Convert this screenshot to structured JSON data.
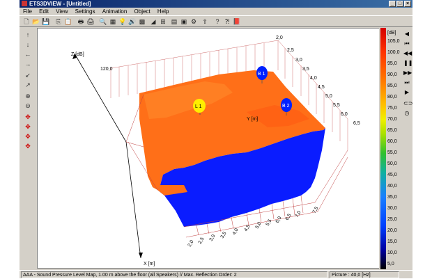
{
  "window": {
    "title": "ETS3DVIEW - [Untitled]",
    "controls": {
      "minimize": "_",
      "maximize": "□",
      "close": "×"
    }
  },
  "menu": [
    "File",
    "Edit",
    "View",
    "Settings",
    "Animation",
    "Object",
    "Help"
  ],
  "toolbar_icons": [
    {
      "name": "new-file-icon",
      "glyph": "🗋"
    },
    {
      "name": "open-folder-icon",
      "glyph": "📂"
    },
    {
      "name": "save-icon",
      "glyph": "💾"
    },
    {
      "name": "copy-icon",
      "glyph": "⎘"
    },
    {
      "name": "paste-icon",
      "glyph": "📋"
    },
    {
      "name": "print-icon",
      "glyph": "🖶"
    },
    {
      "name": "print-preview-icon",
      "glyph": "🖨"
    },
    {
      "name": "zoom-icon",
      "glyph": "🔍"
    },
    {
      "name": "grid-icon",
      "glyph": "▦"
    },
    {
      "name": "bulb-icon",
      "glyph": "💡"
    },
    {
      "name": "speaker-icon",
      "glyph": "🔊"
    },
    {
      "name": "color-map-icon",
      "glyph": "▩"
    },
    {
      "name": "chart-icon",
      "glyph": "◢"
    },
    {
      "name": "graph-icon",
      "glyph": "⊞"
    },
    {
      "name": "table-icon",
      "glyph": "▤"
    },
    {
      "name": "image-icon",
      "glyph": "▣"
    },
    {
      "name": "settings-icon",
      "glyph": "⚙"
    },
    {
      "name": "export-icon",
      "glyph": "⇪"
    },
    {
      "name": "help-icon",
      "glyph": "?"
    },
    {
      "name": "context-help-icon",
      "glyph": "⁈"
    },
    {
      "name": "book-icon",
      "glyph": "📕"
    }
  ],
  "left_tools": [
    {
      "name": "move-up-icon",
      "glyph": "↑"
    },
    {
      "name": "move-down-icon",
      "glyph": "↓"
    },
    {
      "name": "move-left-icon",
      "glyph": "←"
    },
    {
      "name": "move-right-icon",
      "glyph": "→"
    },
    {
      "name": "diagonal-in-icon",
      "glyph": "↙"
    },
    {
      "name": "diagonal-out-icon",
      "glyph": "↗"
    },
    {
      "name": "zoom-in-icon",
      "glyph": "⊕"
    },
    {
      "name": "zoom-out-icon",
      "glyph": "⊖"
    },
    {
      "name": "rotate-x-icon",
      "glyph": "✥"
    },
    {
      "name": "rotate-y-icon",
      "glyph": "✥"
    },
    {
      "name": "rotate-z-icon",
      "glyph": "✥"
    },
    {
      "name": "reset-view-icon",
      "glyph": "✥"
    }
  ],
  "right_tools": [
    {
      "name": "play-back-icon",
      "glyph": "◀"
    },
    {
      "name": "first-frame-icon",
      "glyph": "⏮"
    },
    {
      "name": "rewind-icon",
      "glyph": "◀◀"
    },
    {
      "name": "pause-icon",
      "glyph": "❚❚"
    },
    {
      "name": "fast-forward-icon",
      "glyph": "▶▶"
    },
    {
      "name": "last-frame-icon",
      "glyph": "⏭"
    },
    {
      "name": "play-icon",
      "glyph": "▶"
    },
    {
      "name": "link-icon",
      "glyph": "⊂⊃"
    },
    {
      "name": "clock-icon",
      "glyph": "◷"
    }
  ],
  "legend": {
    "unit": "[dB]",
    "labels": [
      "105,0",
      "100,0",
      "95,0",
      "90,0",
      "85,0",
      "80,0",
      "75,0",
      "70,0",
      "65,0",
      "60,0",
      "55,0",
      "50,0",
      "45,0",
      "40,0",
      "35,0",
      "30,0",
      "25,0",
      "20,0",
      "15,0",
      "10,0",
      "5,0"
    ]
  },
  "plot": {
    "z_axis_label": "Z [dB]",
    "z_tick": "120,0",
    "y_axis_label": "Y [m]",
    "x_axis_label": "X [m]",
    "y_ticks": [
      "2,0",
      "2,5",
      "3,0",
      "3,5",
      "4,0",
      "4,5",
      "5,0",
      "5,5",
      "6,0",
      "6,5"
    ],
    "x_ticks": [
      "2,0",
      "2,5",
      "3,0",
      "3,5",
      "4,0",
      "4,5",
      "5,0",
      "5,5",
      "6,0",
      "6,5",
      "7,0",
      "7,5"
    ],
    "markers": [
      {
        "label": "L 1",
        "color": "#ffee00"
      },
      {
        "label": "B 1",
        "color": "#0020ff"
      },
      {
        "label": "B 2",
        "color": "#0020ff"
      }
    ],
    "surface_colors": {
      "top": "#ff6f18",
      "front": "#0a1cff"
    }
  },
  "status": {
    "main": "AAA - Sound Pressure Level Map, 1.00 m above the floor (all Speakers) // Max. Reflection Order: 2",
    "picture": "Picture : 40,0 [Hz]"
  }
}
